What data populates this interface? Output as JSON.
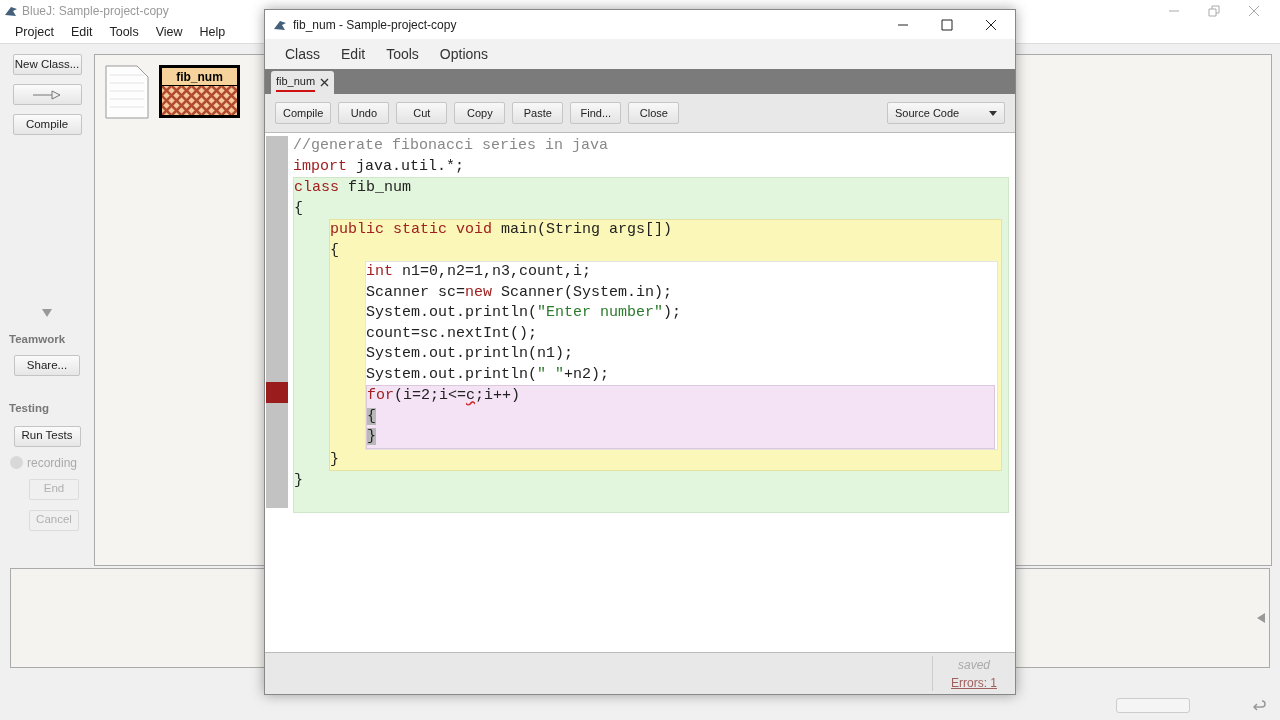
{
  "main_window": {
    "title": "BlueJ: Sample-project-copy",
    "menu": [
      "Project",
      "Edit",
      "Tools",
      "View",
      "Help"
    ],
    "sidebar": {
      "buttons": [
        {
          "kind": "text",
          "label": "New Class...",
          "disabled": false
        },
        {
          "kind": "arrow",
          "disabled": false
        },
        {
          "kind": "text",
          "label": "Compile",
          "disabled": false
        }
      ],
      "teamwork": {
        "title": "Teamwork",
        "buttons": [
          {
            "label": "Share...",
            "disabled": false
          }
        ]
      },
      "testing": {
        "title": "Testing",
        "buttons": [
          {
            "label": "Run Tests",
            "disabled": false
          }
        ],
        "recording": {
          "label": "recording",
          "checked": false,
          "disabled": true
        },
        "controls": [
          {
            "label": "End",
            "disabled": true
          },
          {
            "label": "Cancel",
            "disabled": true
          }
        ]
      }
    },
    "diagram": {
      "classes": [
        {
          "name": "fib_num",
          "compiled": false
        }
      ]
    }
  },
  "editor": {
    "title": "fib_num - Sample-project-copy",
    "menu": [
      "Class",
      "Edit",
      "Tools",
      "Options"
    ],
    "tabs": [
      {
        "label": "fib_num",
        "selected": true
      }
    ],
    "toolbar": [
      "Compile",
      "Undo",
      "Cut",
      "Copy",
      "Paste",
      "Find...",
      "Close"
    ],
    "view_select": "Source Code",
    "code": [
      {
        "kind": "line",
        "tokens": [
          {
            "text": "//generate fibonacci series in java",
            "kind": "comment"
          }
        ]
      },
      {
        "kind": "line",
        "tokens": [
          {
            "text": "import",
            "kind": "keyword"
          },
          {
            "text": " java.util.*;",
            "kind": "plain"
          }
        ]
      },
      {
        "kind": "class",
        "children": [
          {
            "kind": "line",
            "tokens": [
              {
                "text": "class",
                "kind": "keyword"
              },
              {
                "text": " fib_num",
                "kind": "plain"
              }
            ]
          },
          {
            "kind": "line",
            "tokens": [
              {
                "text": "{",
                "kind": "plain"
              }
            ]
          },
          {
            "kind": "method",
            "children": [
              {
                "kind": "line",
                "tokens": [
                  {
                    "text": "public static void",
                    "kind": "keyword"
                  },
                  {
                    "text": " main(String args[])",
                    "kind": "plain"
                  }
                ]
              },
              {
                "kind": "line",
                "tokens": [
                  {
                    "text": "{",
                    "kind": "plain"
                  }
                ]
              },
              {
                "kind": "body",
                "children": [
                  {
                    "kind": "line",
                    "tokens": [
                      {
                        "text": "int",
                        "kind": "keyword"
                      },
                      {
                        "text": " n1=0,n2=1,n3,count,i;",
                        "kind": "plain"
                      }
                    ]
                  },
                  {
                    "kind": "line",
                    "tokens": [
                      {
                        "text": "Scanner sc=",
                        "kind": "plain"
                      },
                      {
                        "text": "new",
                        "kind": "keyword"
                      },
                      {
                        "text": " Scanner(System.in);",
                        "kind": "plain"
                      }
                    ]
                  },
                  {
                    "kind": "line",
                    "tokens": [
                      {
                        "text": "System.out.println(",
                        "kind": "plain"
                      },
                      {
                        "text": "\"Enter number\"",
                        "kind": "string"
                      },
                      {
                        "text": ");",
                        "kind": "plain"
                      }
                    ]
                  },
                  {
                    "kind": "line",
                    "tokens": [
                      {
                        "text": "count=sc.nextInt();",
                        "kind": "plain"
                      }
                    ]
                  },
                  {
                    "kind": "line",
                    "tokens": [
                      {
                        "text": "System.out.println(n1);",
                        "kind": "plain"
                      }
                    ]
                  },
                  {
                    "kind": "line",
                    "tokens": [
                      {
                        "text": "System.out.println(",
                        "kind": "plain"
                      },
                      {
                        "text": "\" \"",
                        "kind": "string"
                      },
                      {
                        "text": "+n2);",
                        "kind": "plain"
                      }
                    ]
                  },
                  {
                    "kind": "loop",
                    "children": [
                      {
                        "kind": "line",
                        "error": true,
                        "tokens": [
                          {
                            "text": "for",
                            "kind": "keyword"
                          },
                          {
                            "text": "(i=2;i<=",
                            "kind": "plain"
                          },
                          {
                            "text": "c",
                            "kind": "error"
                          },
                          {
                            "text": ";i++)",
                            "kind": "plain"
                          }
                        ]
                      },
                      {
                        "kind": "line",
                        "tokens": [
                          {
                            "text": "{",
                            "kind": "match"
                          }
                        ]
                      },
                      {
                        "kind": "line",
                        "tokens": [
                          {
                            "text": "}",
                            "kind": "match"
                          }
                        ]
                      }
                    ]
                  }
                ]
              },
              {
                "kind": "line",
                "tokens": [
                  {
                    "text": "}",
                    "kind": "plain"
                  }
                ]
              }
            ]
          },
          {
            "kind": "line",
            "tokens": [
              {
                "text": "}",
                "kind": "plain"
              }
            ]
          }
        ]
      }
    ],
    "status": {
      "saved": "saved",
      "errors": "Errors: 1"
    }
  }
}
